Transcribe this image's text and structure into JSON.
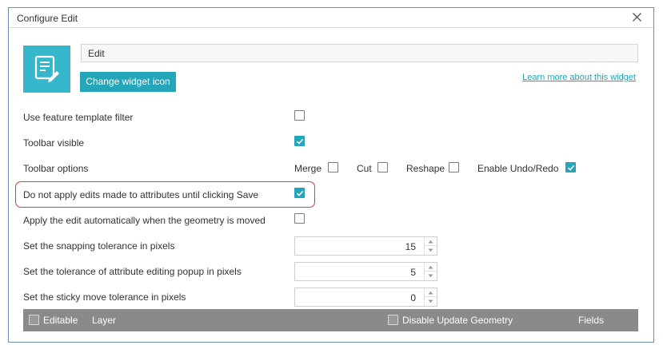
{
  "dialog": {
    "title": "Configure Edit",
    "close_icon": "close-icon"
  },
  "widget": {
    "icon": "edit-form-icon",
    "icon_color": "#36b7cc",
    "name_value": "Edit",
    "change_icon_label": "Change widget icon",
    "learn_more_label": "Learn more about this widget"
  },
  "settings": {
    "feature_template_filter": {
      "label": "Use feature template filter",
      "checked": false
    },
    "toolbar_visible": {
      "label": "Toolbar visible",
      "checked": true
    },
    "toolbar_options": {
      "label": "Toolbar options",
      "merge": {
        "label": "Merge",
        "checked": false
      },
      "cut": {
        "label": "Cut",
        "checked": false
      },
      "reshape": {
        "label": "Reshape",
        "checked": false
      },
      "undo_redo": {
        "label": "Enable Undo/Redo",
        "checked": true
      }
    },
    "delay_attribute_edits": {
      "label": "Do not apply edits made to attributes until clicking Save",
      "checked": true
    },
    "auto_apply_on_move": {
      "label": "Apply the edit automatically when the geometry is moved",
      "checked": false
    },
    "snapping_tolerance": {
      "label": "Set the snapping tolerance in pixels",
      "value": "15"
    },
    "popup_tolerance": {
      "label": "Set the tolerance of attribute editing popup in pixels",
      "value": "5"
    },
    "sticky_move_tolerance": {
      "label": "Set the sticky move tolerance in pixels",
      "value": "0"
    }
  },
  "layer_table": {
    "editable_label": "Editable",
    "layer_label": "Layer",
    "disable_update_geometry_label": "Disable Update Geometry",
    "fields_label": "Fields"
  },
  "colors": {
    "accent": "#24a5b9",
    "highlight_border": "#e03a3a",
    "table_header": "#8a8a8a"
  }
}
